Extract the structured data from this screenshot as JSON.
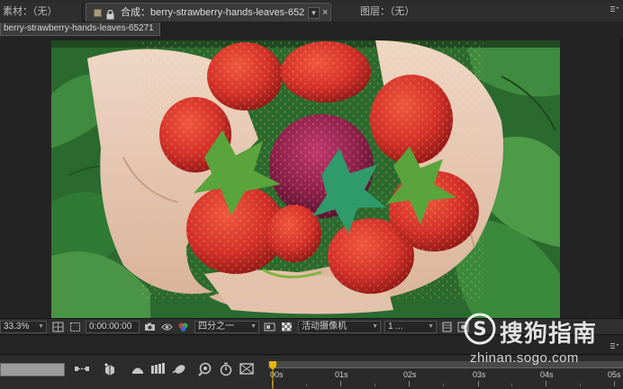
{
  "tabs": {
    "footage_label": "素材：（无）",
    "comp_label": "合成：berry-strawberry-hands-leaves-65271",
    "comp_close": "×",
    "layer_label": "图层：（无）",
    "dropdown_glyph": "▼"
  },
  "comp_subtab": "berry-strawberry-hands-leaves-65271",
  "controls": {
    "zoom": "33.3%",
    "timecode": "0:00:00:00",
    "resolution": "四分之一",
    "camera": "活动摄像机",
    "views": "1 ..."
  },
  "timeline": {
    "ticks": [
      "00s",
      "01s",
      "02s",
      "03s",
      "04s",
      "05s"
    ]
  },
  "watermark": {
    "brand": "搜狗指南",
    "url": "zhinan.sogo.com"
  },
  "colors": {
    "panel_bg": "#232323",
    "tab_active_bg": "#3b3b3b",
    "playhead": "#e6b400",
    "leaf_green": "#2f7a34",
    "berry_red": "#d8362c"
  }
}
